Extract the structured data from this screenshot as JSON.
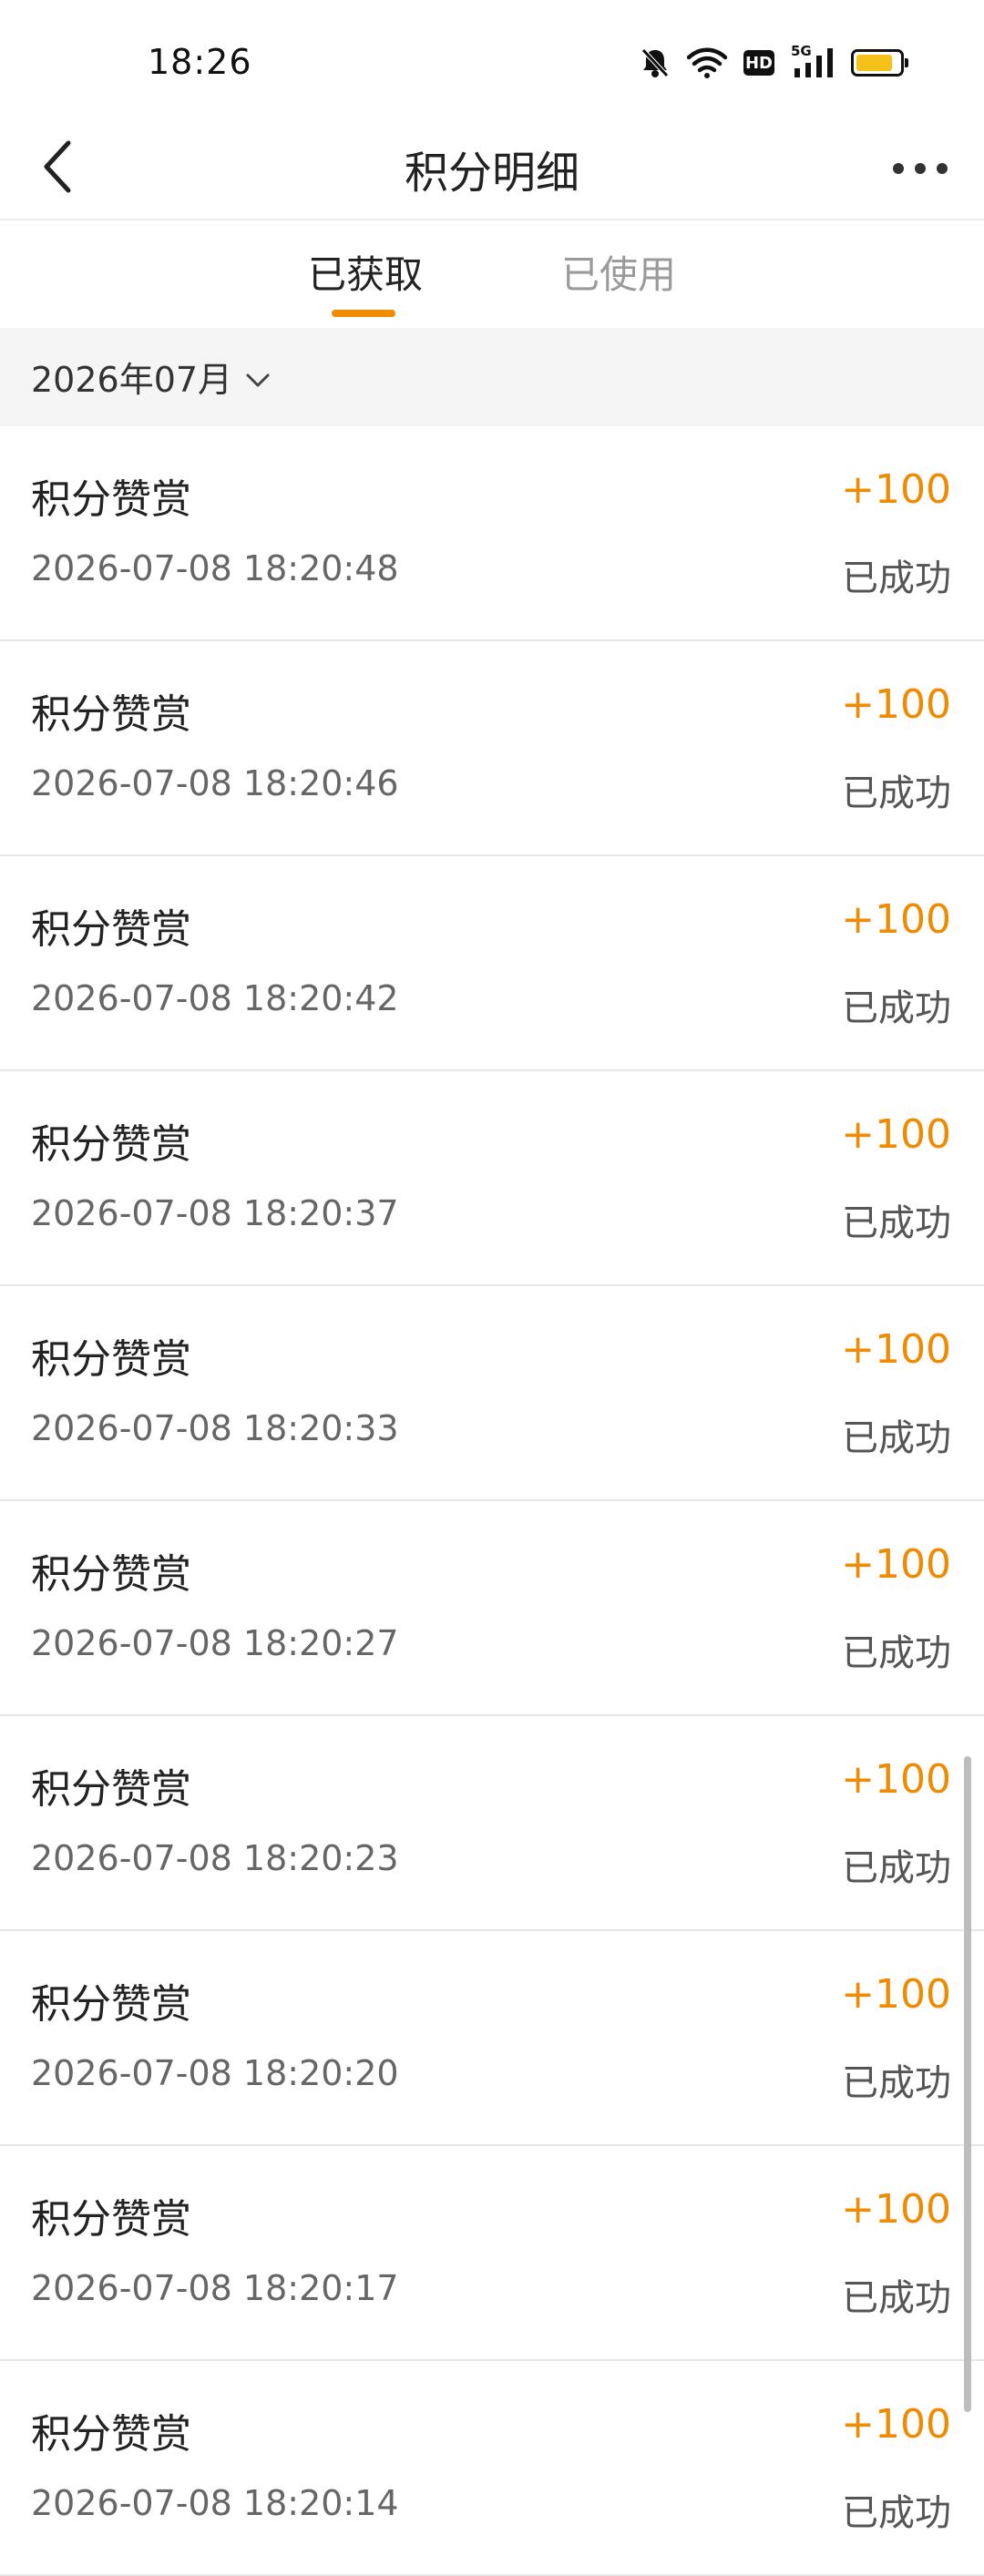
{
  "status_bar": {
    "time": "18:26",
    "icons": [
      "mute-bell-icon",
      "wifi-icon",
      "hd-icon",
      "5g-signal-icon",
      "battery-icon"
    ],
    "hd_label": "HD",
    "network_label": "5G",
    "battery_level": 0.85,
    "battery_color": "#f4c21b"
  },
  "nav": {
    "title": "积分明细",
    "back_icon": "chevron-left-icon",
    "more_icon": "more-horizontal-icon"
  },
  "tabs": [
    {
      "label": "已获取",
      "active": true
    },
    {
      "label": "已使用",
      "active": false
    }
  ],
  "accent_color": "#f08a00",
  "filter": {
    "month": "2026年07月",
    "icon": "chevron-down-icon"
  },
  "records": [
    {
      "title": "积分赞赏",
      "time": "2026-07-08 18:20:48",
      "points": "+100",
      "status": "已成功"
    },
    {
      "title": "积分赞赏",
      "time": "2026-07-08 18:20:46",
      "points": "+100",
      "status": "已成功"
    },
    {
      "title": "积分赞赏",
      "time": "2026-07-08 18:20:42",
      "points": "+100",
      "status": "已成功"
    },
    {
      "title": "积分赞赏",
      "time": "2026-07-08 18:20:37",
      "points": "+100",
      "status": "已成功"
    },
    {
      "title": "积分赞赏",
      "time": "2026-07-08 18:20:33",
      "points": "+100",
      "status": "已成功"
    },
    {
      "title": "积分赞赏",
      "time": "2026-07-08 18:20:27",
      "points": "+100",
      "status": "已成功"
    },
    {
      "title": "积分赞赏",
      "time": "2026-07-08 18:20:23",
      "points": "+100",
      "status": "已成功"
    },
    {
      "title": "积分赞赏",
      "time": "2026-07-08 18:20:20",
      "points": "+100",
      "status": "已成功"
    },
    {
      "title": "积分赞赏",
      "time": "2026-07-08 18:20:17",
      "points": "+100",
      "status": "已成功"
    },
    {
      "title": "积分赞赏",
      "time": "2026-07-08 18:20:14",
      "points": "+100",
      "status": "已成功"
    }
  ]
}
